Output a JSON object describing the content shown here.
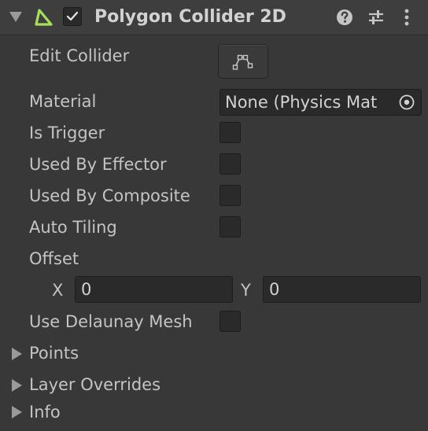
{
  "component": {
    "title": "Polygon Collider 2D",
    "enabled": true,
    "icon": "polygon-collider-2d-icon",
    "accent_color": "#a6e05a",
    "header_icons": [
      "help-icon",
      "preset-sliders-icon",
      "kebab-menu-icon"
    ]
  },
  "fields": {
    "edit_collider": {
      "label": "Edit Collider",
      "icon": "edit-collider-icon"
    },
    "material": {
      "label": "Material",
      "value": "None (Physics Mat",
      "picker_icon": "object-picker-icon"
    },
    "is_trigger": {
      "label": "Is Trigger",
      "checked": false
    },
    "used_by_effector": {
      "label": "Used By Effector",
      "checked": false
    },
    "used_by_composite": {
      "label": "Used By Composite",
      "checked": false
    },
    "auto_tiling": {
      "label": "Auto Tiling",
      "checked": false
    },
    "offset": {
      "label": "Offset",
      "x_label": "X",
      "x_value": "0",
      "y_label": "Y",
      "y_value": "0"
    },
    "use_delaunay_mesh": {
      "label": "Use Delaunay Mesh",
      "checked": false
    }
  },
  "foldouts": [
    {
      "label": "Points",
      "expanded": false
    },
    {
      "label": "Layer Overrides",
      "expanded": false
    },
    {
      "label": "Info",
      "expanded": false
    }
  ]
}
